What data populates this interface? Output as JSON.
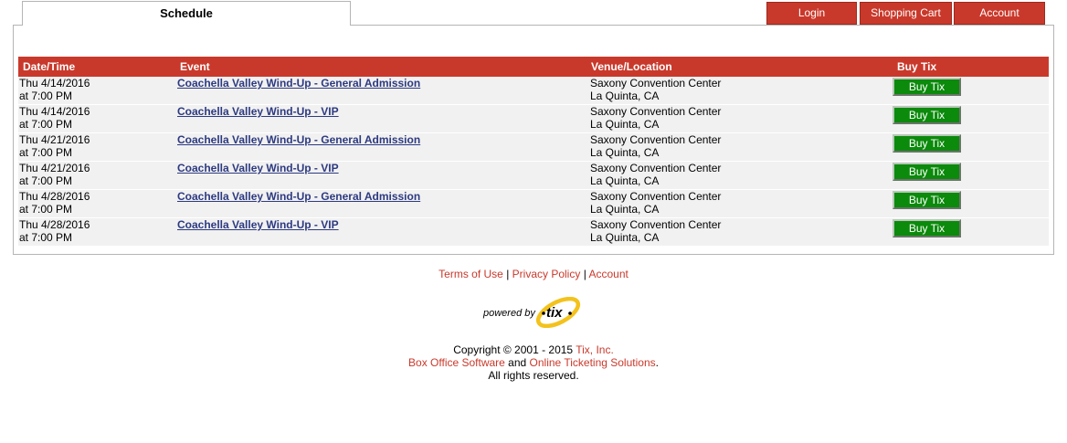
{
  "tabs": {
    "schedule": "Schedule"
  },
  "nav": {
    "login": "Login",
    "cart": "Shopping Cart",
    "account": "Account"
  },
  "table": {
    "headers": [
      "Date/Time",
      "Event",
      "Venue/Location",
      "Buy Tix"
    ],
    "rows": [
      {
        "date": "Thu 4/14/2016",
        "time": "at 7:00 PM",
        "event": "Coachella Valley Wind-Up - General Admission",
        "venue": "Saxony Convention Center",
        "city": "La Quinta, CA",
        "buy": "Buy Tix"
      },
      {
        "date": "Thu 4/14/2016",
        "time": "at 7:00 PM",
        "event": "Coachella Valley Wind-Up - VIP",
        "venue": "Saxony Convention Center",
        "city": "La Quinta, CA",
        "buy": "Buy Tix"
      },
      {
        "date": "Thu 4/21/2016",
        "time": "at 7:00 PM",
        "event": "Coachella Valley Wind-Up - General Admission",
        "venue": "Saxony Convention Center",
        "city": "La Quinta, CA",
        "buy": "Buy Tix"
      },
      {
        "date": "Thu 4/21/2016",
        "time": "at 7:00 PM",
        "event": "Coachella Valley Wind-Up - VIP",
        "venue": "Saxony Convention Center",
        "city": "La Quinta, CA",
        "buy": "Buy Tix"
      },
      {
        "date": "Thu 4/28/2016",
        "time": "at 7:00 PM",
        "event": "Coachella Valley Wind-Up - General Admission",
        "venue": "Saxony Convention Center",
        "city": "La Quinta, CA",
        "buy": "Buy Tix"
      },
      {
        "date": "Thu 4/28/2016",
        "time": "at 7:00 PM",
        "event": "Coachella Valley Wind-Up - VIP",
        "venue": "Saxony Convention Center",
        "city": "La Quinta, CA",
        "buy": "Buy Tix"
      }
    ]
  },
  "footer": {
    "terms": "Terms of Use",
    "privacy": "Privacy Policy",
    "account": "Account",
    "separator": "|"
  },
  "logo": {
    "powered_by": "powered by",
    "brand": "tix"
  },
  "copyright": {
    "prefix": "Copyright © 2001 - 2015 ",
    "company": "Tix, Inc.",
    "line2_link1": "Box Office Software",
    "line2_and": " and ",
    "line2_link2": "Online Ticketing Solutions",
    "line2_end": ".",
    "line3": "All rights reserved."
  },
  "colors": {
    "accent": "#c9392b",
    "buy": "#0b8a0b",
    "link": "#2d3a80",
    "row": "#f1f1f1"
  }
}
